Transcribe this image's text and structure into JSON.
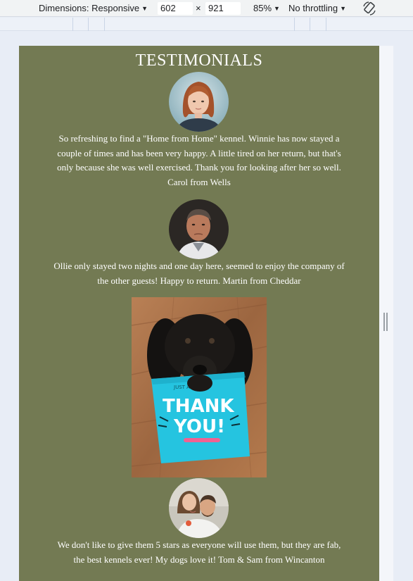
{
  "devtools": {
    "dimensions_label": "Dimensions: Responsive",
    "width_value": "602",
    "times_sign": "×",
    "height_value": "921",
    "zoom": "85%",
    "throttling": "No throttling"
  },
  "page": {
    "title": "TESTIMONIALS",
    "testimonials": [
      {
        "line1": "So refreshing to find a \"Home from Home\" kennel. Winnie has now stayed a",
        "line2": "couple of times and has been very happy. A little tired on her return, but that's",
        "line3": "only because she was well exercised. Thank you for looking after her so well.",
        "line4": "Carol from Wells"
      },
      {
        "line1": "Ollie only stayed two nights and one day here, seemed to enjoy the company of",
        "line2": "the other guests! Happy to return. Martin from Cheddar"
      },
      {
        "line1": "We don't like to give them 5 stars as everyone will use them, but they are fab,",
        "line2": "the best kennels ever! My dogs love it! Tom & Sam from Wincanton"
      }
    ],
    "card": {
      "top_text": "JUST A LITTLE",
      "line1": "THANK",
      "line2": "YOU!"
    }
  },
  "colors": {
    "page_background": "#737a53",
    "card_blue": "#25c4e0"
  },
  "icons": [
    "dropdown-caret-icon",
    "rotate-icon",
    "resize-handle-icon"
  ]
}
